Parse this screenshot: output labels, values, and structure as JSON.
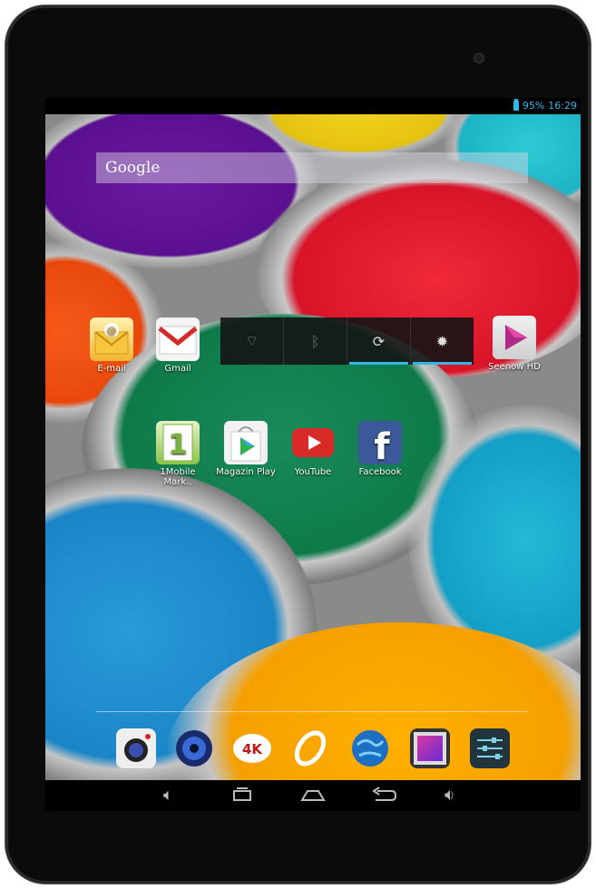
{
  "status": {
    "battery": "95%",
    "time": "16:29"
  },
  "search": {
    "label": "Google"
  },
  "apps_row1": [
    {
      "label": "E-mail",
      "icon": "email-icon"
    },
    {
      "label": "Gmail",
      "icon": "gmail-icon"
    }
  ],
  "power_widget": [
    "wifi-icon",
    "bluetooth-icon",
    "sync-icon",
    "brightness-icon"
  ],
  "apps_row1_right": {
    "label": "Seenow HD",
    "icon": "seenow-icon"
  },
  "apps_row2": [
    {
      "label": "1Mobile Mark..",
      "icon": "1mobile-icon"
    },
    {
      "label": "Magazin Play",
      "icon": "play-store-icon"
    },
    {
      "label": "YouTube",
      "icon": "youtube-icon"
    },
    {
      "label": "Facebook",
      "icon": "facebook-icon"
    }
  ],
  "dock": [
    "camera-icon",
    "music-icon",
    "video-4k-icon",
    "browser-swirl-icon",
    "globe-icon",
    "gallery-icon",
    "settings-icon"
  ],
  "colors": {
    "accent": "#33b5e5",
    "youtube": "#d92a2a",
    "facebook": "#3b5998"
  }
}
